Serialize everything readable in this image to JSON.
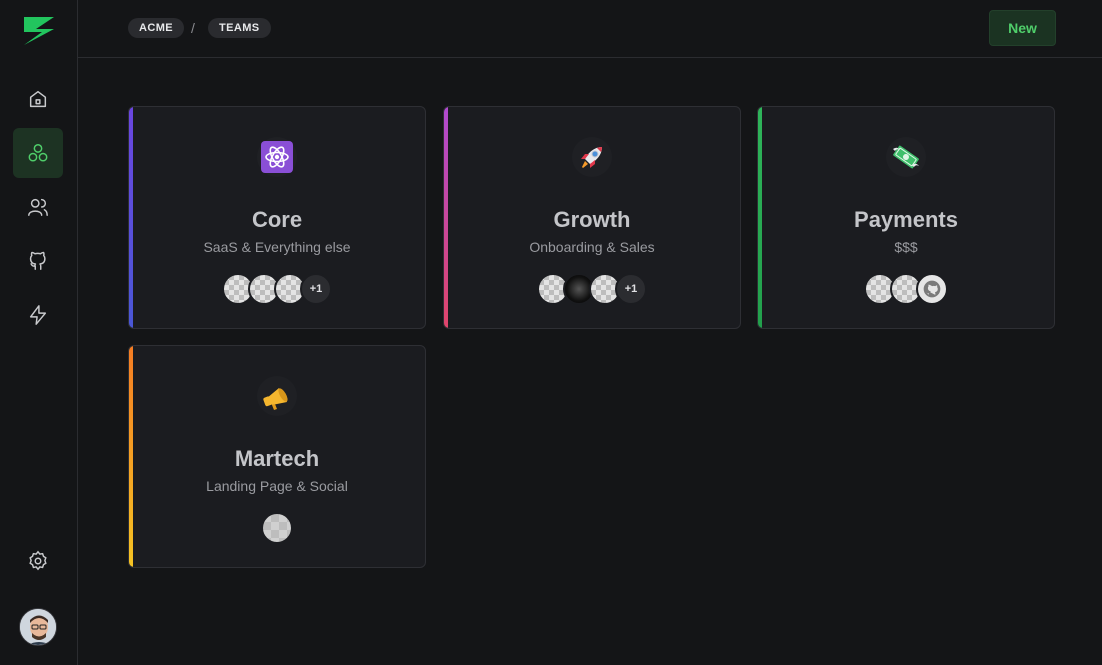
{
  "breadcrumb": [
    "ACME",
    "TEAMS"
  ],
  "breadcrumb_separator": "/",
  "header": {
    "new_button": "New"
  },
  "colors": {
    "brand": "#22c55e",
    "core_accent": "#6b46e0",
    "growth_accent": "#c9427c",
    "payments_accent": "#2fb55a",
    "martech_accent": "#f5a623"
  },
  "sidebar": {
    "items": [
      {
        "icon": "home-icon"
      },
      {
        "icon": "teams-icon",
        "active": true
      },
      {
        "icon": "users-icon"
      },
      {
        "icon": "github-icon"
      },
      {
        "icon": "lightning-icon"
      }
    ],
    "bottom": [
      {
        "icon": "gear-icon"
      },
      {
        "icon": "user-avatar"
      }
    ]
  },
  "teams": [
    {
      "name": "Core",
      "description": "SaaS & Everything else",
      "icon": "atom-icon",
      "extra_members": "+1"
    },
    {
      "name": "Growth",
      "description": "Onboarding & Sales",
      "icon": "rocket-icon",
      "extra_members": "+1"
    },
    {
      "name": "Payments",
      "description": "$$$",
      "icon": "money-icon"
    },
    {
      "name": "Martech",
      "description": "Landing Page & Social",
      "icon": "megaphone-icon"
    }
  ]
}
